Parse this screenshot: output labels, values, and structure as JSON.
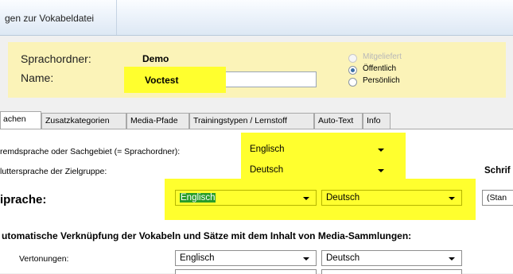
{
  "window": {
    "title": "gen zur Vokabeldatei"
  },
  "info": {
    "folder_label": "Sprachordner:",
    "folder_value": "Demo",
    "name_label": "Name:",
    "name_value": "Voctest",
    "visibility_options": [
      {
        "label": "Mitgeliefert",
        "state": "disabled"
      },
      {
        "label": "Öffentlich",
        "state": "selected"
      },
      {
        "label": "Persönlich",
        "state": "unselected"
      }
    ]
  },
  "tabs": [
    "achen",
    "Zusatzkategorien",
    "Media-Pfade",
    "Trainingstypen / Lernstoff",
    "Auto-Text",
    "Info"
  ],
  "active_tab": 0,
  "form": {
    "foreign_label": "remdsprache oder Sachgebiet (= Sprachordner):",
    "foreign_value": "Englisch",
    "mother_label": "luttersprache der Zielgruppe:",
    "mother_value": "Deutsch",
    "font_label": "Schrif",
    "language_label": "iprache:",
    "language_from": "Englisch",
    "language_to": "Deutsch",
    "standard_partial": "(Stan",
    "media_heading": "utomatische Verknüpfung der Vokabeln und Sätze mit dem Inhalt von Media-Sammlungen:",
    "sound_label": "Vertonungen:",
    "sound_from": "Englisch",
    "sound_to": "Deutsch"
  },
  "colors": {
    "highlight": "#ffff2e",
    "panel": "#fbf3b8",
    "selection": "#2a9d2a"
  }
}
